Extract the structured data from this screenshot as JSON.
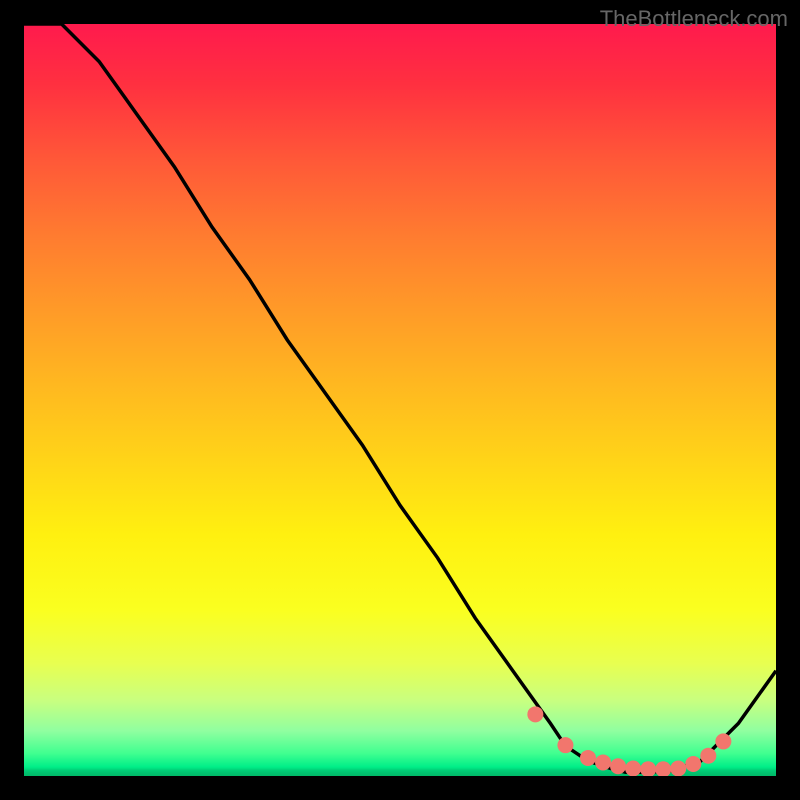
{
  "watermark": "TheBottleneck.com",
  "chart_data": {
    "type": "line",
    "title": "",
    "xlabel": "",
    "ylabel": "",
    "xlim": [
      0,
      100
    ],
    "ylim": [
      0,
      100
    ],
    "legend": false,
    "grid": false,
    "background": "red-yellow-green vertical gradient (red top, green bottom)",
    "series": [
      {
        "name": "bottleneck-curve",
        "x": [
          0,
          5,
          10,
          15,
          20,
          25,
          30,
          35,
          40,
          45,
          50,
          55,
          60,
          65,
          70,
          72,
          75,
          78,
          80,
          83,
          86,
          90,
          95,
          100
        ],
        "values": [
          100,
          100,
          95,
          88,
          81,
          73,
          66,
          58,
          51,
          44,
          36,
          29,
          21,
          14,
          7,
          4,
          2,
          1,
          0.5,
          0.5,
          0.7,
          2,
          7,
          14
        ]
      }
    ],
    "markers": {
      "name": "highlight-points",
      "x": [
        68,
        72,
        75,
        77,
        79,
        81,
        83,
        85,
        87,
        89,
        91,
        93
      ],
      "values": [
        8.2,
        4.1,
        2.4,
        1.8,
        1.3,
        1.0,
        0.9,
        0.9,
        1.0,
        1.6,
        2.7,
        4.6
      ]
    }
  }
}
